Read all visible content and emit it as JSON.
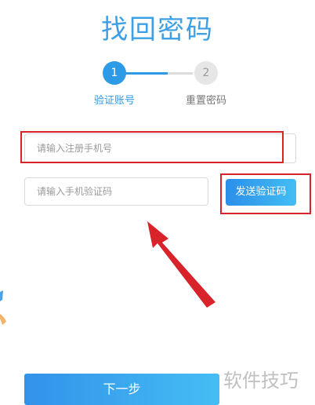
{
  "page": {
    "title": "找回密码"
  },
  "steps": [
    {
      "number": "1",
      "label": "验证账号",
      "active": true
    },
    {
      "number": "2",
      "label": "重置密码",
      "active": false
    }
  ],
  "progress": {
    "fraction": 0.63
  },
  "form": {
    "phone_placeholder": "请输入注册手机号",
    "code_placeholder": "请输入手机验证码",
    "send_code_label": "发送验证码",
    "next_label": "下一步"
  },
  "watermark": "软件技巧",
  "colors": {
    "accent": "#2d9ae6",
    "highlight": "#d8232b"
  }
}
